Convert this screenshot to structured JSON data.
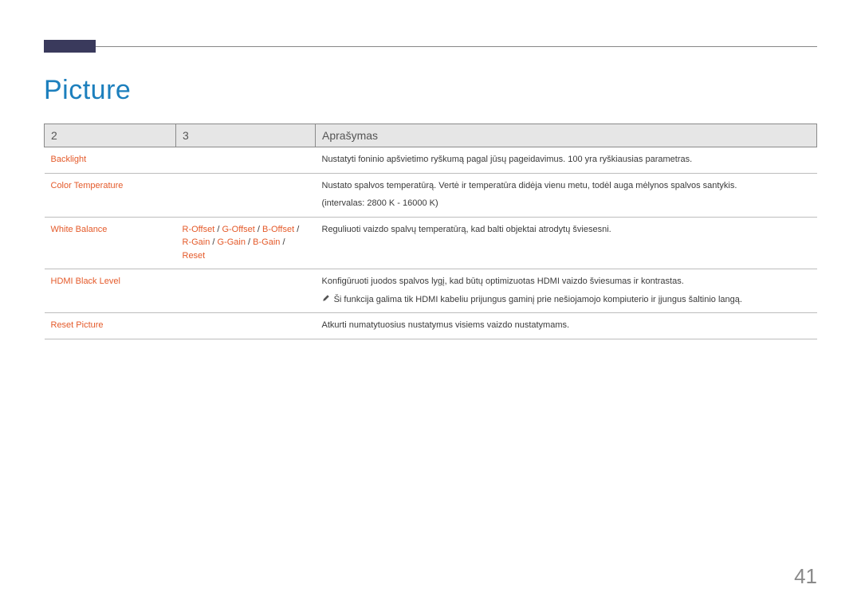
{
  "title": "Picture",
  "page_number": "41",
  "headers": {
    "col1": "2",
    "col2": "3",
    "col3": "Aprašymas"
  },
  "rows": {
    "backlight": {
      "menu": "Backlight",
      "desc": "Nustatyti foninio apšvietimo ryškumą pagal jūsų pageidavimus. 100 yra ryškiausias parametras."
    },
    "colortemp": {
      "menu": "Color Temperature",
      "desc_line1": "Nustato spalvos temperatūrą. Vertė ir temperatūra didėja vienu metu, todėl auga mėlynos spalvos santykis.",
      "desc_line2": "(intervalas: 2800 K - 16000 K)"
    },
    "whitebalance": {
      "menu": "White Balance",
      "sub": {
        "r_offset": "R-Offset",
        "g_offset": "G-Offset",
        "b_offset": "B-Offset",
        "r_gain": "R-Gain",
        "g_gain": "G-Gain",
        "b_gain": "B-Gain",
        "reset": "Reset",
        "sep": " / "
      },
      "desc": "Reguliuoti vaizdo spalvų temperatūrą, kad balti objektai atrodytų šviesesni."
    },
    "hdmi": {
      "menu": "HDMI Black Level",
      "desc": "Konfigūruoti juodos spalvos lygį, kad būtų optimizuotas HDMI vaizdo šviesumas ir kontrastas.",
      "note": "Ši funkcija galima tik HDMI kabeliu prijungus gaminį prie nešiojamojo kompiuterio ir įjungus šaltinio langą."
    },
    "reset": {
      "menu": "Reset Picture",
      "desc": "Atkurti numatytuosius nustatymus visiems vaizdo nustatymams."
    }
  }
}
